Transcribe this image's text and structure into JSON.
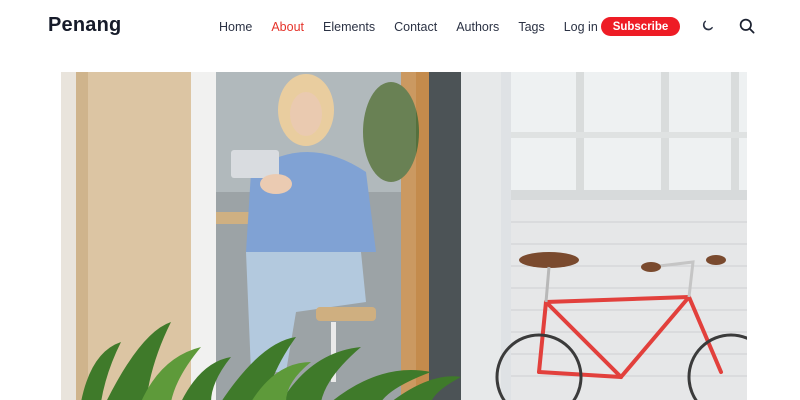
{
  "site": {
    "logo": "Penang"
  },
  "nav": {
    "items": [
      {
        "label": "Home",
        "active": false
      },
      {
        "label": "About",
        "active": true
      },
      {
        "label": "Elements",
        "active": false
      },
      {
        "label": "Contact",
        "active": false
      },
      {
        "label": "Authors",
        "active": false
      },
      {
        "label": "Tags",
        "active": false
      },
      {
        "label": "Log in",
        "active": false
      }
    ],
    "subscribe_label": "Subscribe"
  },
  "icons": {
    "theme_toggle": "moon-icon",
    "search": "search-icon"
  },
  "colors": {
    "accent": "#ee1c25",
    "active_link": "#e5332a",
    "text": "#2b3244"
  }
}
